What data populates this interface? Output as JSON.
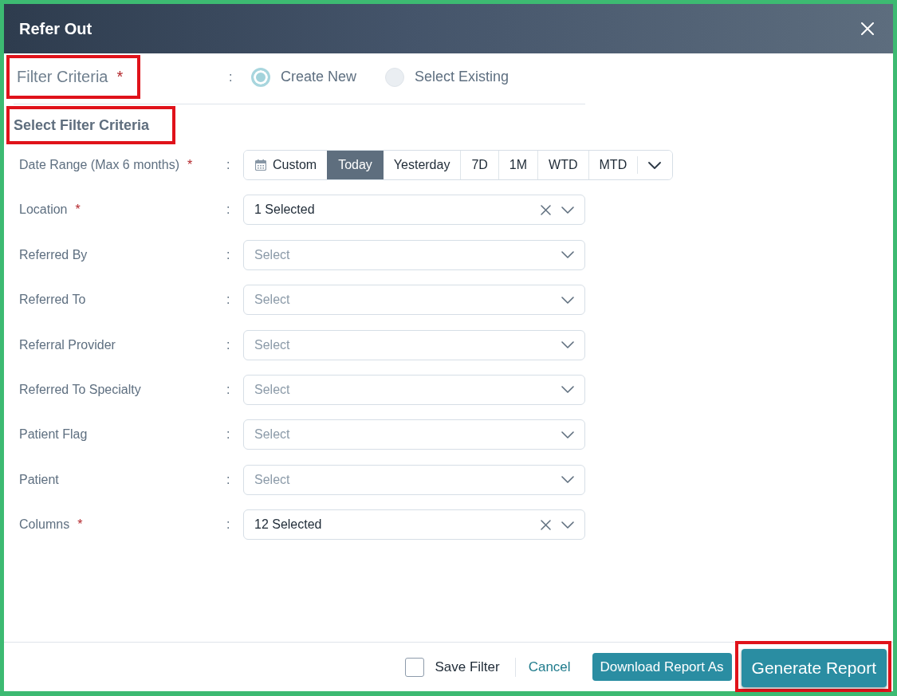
{
  "window": {
    "title": "Refer Out"
  },
  "filter_mode": {
    "label": "Filter Criteria",
    "required_mark": "*",
    "highlighted": true,
    "separator": ":",
    "options": [
      {
        "label": "Create New",
        "selected": true
      },
      {
        "label": "Select Existing",
        "selected": false
      }
    ]
  },
  "section": {
    "title": "Select Filter Criteria",
    "highlighted": true
  },
  "fields": [
    {
      "label": "Date Range (Max 6 months)",
      "required_mark": "*",
      "separator": ":",
      "kind": "segments",
      "segments": [
        {
          "kind": "calendar",
          "label": "Custom",
          "selected": false
        },
        {
          "kind": "text",
          "label": "Today",
          "selected": true
        },
        {
          "kind": "text",
          "label": "Yesterday",
          "selected": false
        },
        {
          "kind": "text",
          "label": "7D",
          "selected": false
        },
        {
          "kind": "text",
          "label": "1M",
          "selected": false
        },
        {
          "kind": "text",
          "label": "WTD",
          "selected": false
        },
        {
          "kind": "text",
          "label": "MTD",
          "selected": false
        },
        {
          "kind": "dropdown",
          "selected": false
        }
      ]
    },
    {
      "label": "Location",
      "required_mark": "*",
      "separator": ":",
      "kind": "select",
      "value": "1 Selected"
    },
    {
      "label": "Referred By",
      "separator": ":",
      "kind": "select",
      "placeholder": "Select"
    },
    {
      "label": "Referred To",
      "separator": ":",
      "kind": "select",
      "placeholder": "Select"
    },
    {
      "label": "Referral Provider",
      "separator": ":",
      "kind": "select",
      "placeholder": "Select"
    },
    {
      "label": "Referred To Specialty",
      "separator": ":",
      "kind": "select",
      "placeholder": "Select"
    },
    {
      "label": "Patient Flag",
      "separator": ":",
      "kind": "select",
      "placeholder": "Select"
    },
    {
      "label": "Patient",
      "separator": ":",
      "kind": "select",
      "placeholder": "Select"
    },
    {
      "label": "Columns",
      "required_mark": "*",
      "separator": ":",
      "kind": "select",
      "value": "12 Selected"
    }
  ],
  "footer": {
    "save_filter": {
      "label": "Save Filter",
      "checked": false
    },
    "cancel": "Cancel",
    "buttons": [
      {
        "label": "Download Report As",
        "highlighted": false
      },
      {
        "label": "Generate Report",
        "highlighted": true
      }
    ]
  }
}
